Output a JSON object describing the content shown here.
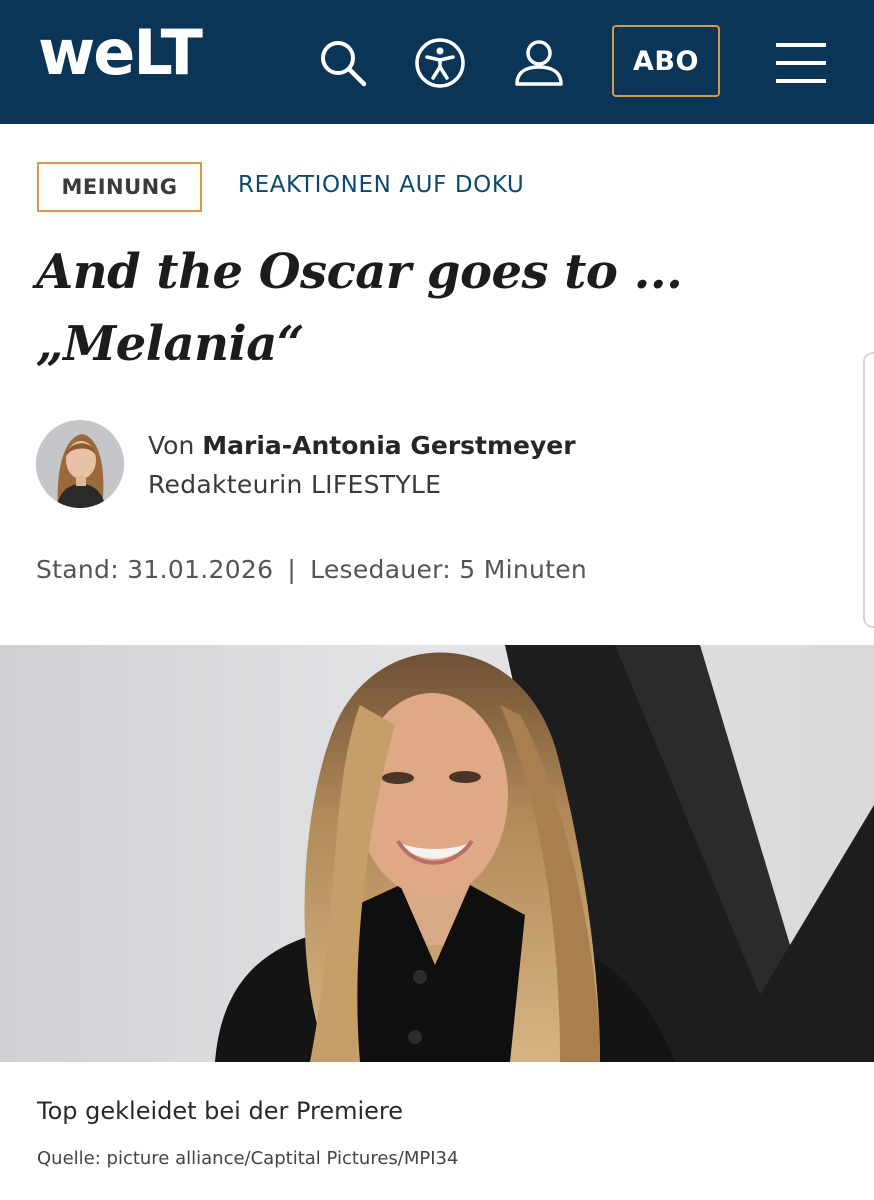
{
  "header": {
    "logo_main": "we",
    "logo_caps": "LT",
    "abo_label": "ABO",
    "icons": [
      "search-icon",
      "accessibility-icon",
      "user-icon",
      "menu-icon"
    ],
    "background_color": "#0b3556",
    "accent_color": "#d69a48"
  },
  "article": {
    "category": "MEINUNG",
    "topic": "REAKTIONEN AUF DOKU",
    "headline_line1": "And the Oscar goes to ...",
    "headline_line2": "„Melania“",
    "author_prefix": "Von",
    "author_name": "Maria-Antonia Gerstmeyer",
    "author_role": "Redakteurin LIFESTYLE",
    "date": "Stand: 31.01.2026",
    "separator": "|",
    "reading_time": "Lesedauer: 5 Minuten"
  },
  "image": {
    "caption": "Top gekleidet bei der Premiere",
    "credit": "Quelle: picture alliance/Captital Pictures/MPI34"
  }
}
